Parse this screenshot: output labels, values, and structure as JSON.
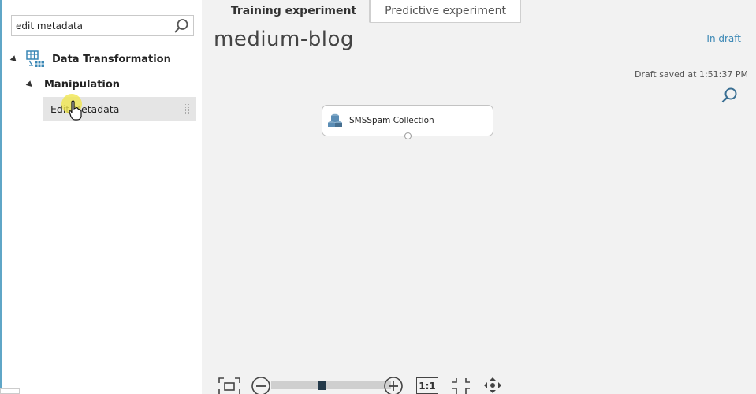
{
  "palette": {
    "search": {
      "value": "edit metadata"
    },
    "tree": {
      "category": "Data Transformation",
      "subcategory": "Manipulation",
      "module": "Edit Metadata"
    }
  },
  "tabs": [
    {
      "label": "Training experiment",
      "active": true
    },
    {
      "label": "Predictive experiment",
      "active": false
    }
  ],
  "experiment": {
    "title": "medium-blog",
    "status": "In draft",
    "saved": "Draft saved at 1:51:37 PM"
  },
  "canvas": {
    "module_label": "SMSSpam Collection"
  },
  "toolbar": {
    "actual_size_label": "1:1"
  },
  "colors": {
    "accent": "#3a87b5",
    "palette_border": "#5fa6c7",
    "canvas_bg": "#f2f2f2"
  }
}
